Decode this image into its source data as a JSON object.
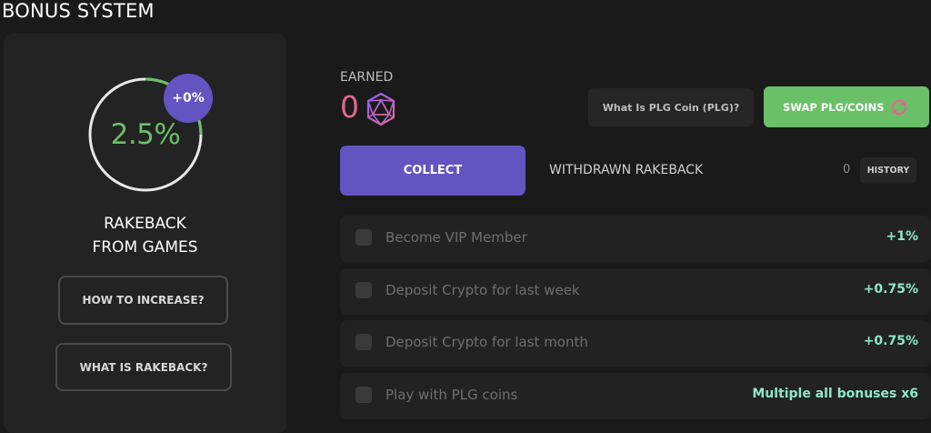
{
  "page": {
    "title": "BONUS SYSTEM"
  },
  "left_panel": {
    "rakeback_percent": "2.5%",
    "bonus_badge": "+0%",
    "ring_progress_fraction": 0.25,
    "rakeback_label_line1": "RAKEBACK",
    "rakeback_label_line2": "FROM GAMES",
    "how_to_increase_label": "HOW TO INCREASE?",
    "what_is_rakeback_label": "WHAT IS RAKEBACK?"
  },
  "earned": {
    "label": "EARNED",
    "value": "0",
    "icon": "plg-coin-icon"
  },
  "plg_info_label": "What Is PLG Coin (PLG)?",
  "swap": {
    "label": "SWAP PLG/COINS",
    "icon": "swap-icon"
  },
  "collect_label": "COLLECT",
  "withdrawn": {
    "label": "WITHDRAWN RAKEBACK",
    "value": "0",
    "history_label": "HISTORY"
  },
  "bonuses": [
    {
      "label": "Become VIP Member",
      "value": "+1%"
    },
    {
      "label": "Deposit Crypto for last week",
      "value": "+0.75%"
    },
    {
      "label": "Deposit Crypto for last month",
      "value": "+0.75%"
    },
    {
      "label": "Play with PLG coins",
      "value": "Multiple all bonuses x6"
    }
  ],
  "colors": {
    "accent_purple": "#6354c2",
    "accent_green": "#6abf69",
    "earned_pink": "#e0688f",
    "bonus_value_mint": "#8de8c8"
  }
}
